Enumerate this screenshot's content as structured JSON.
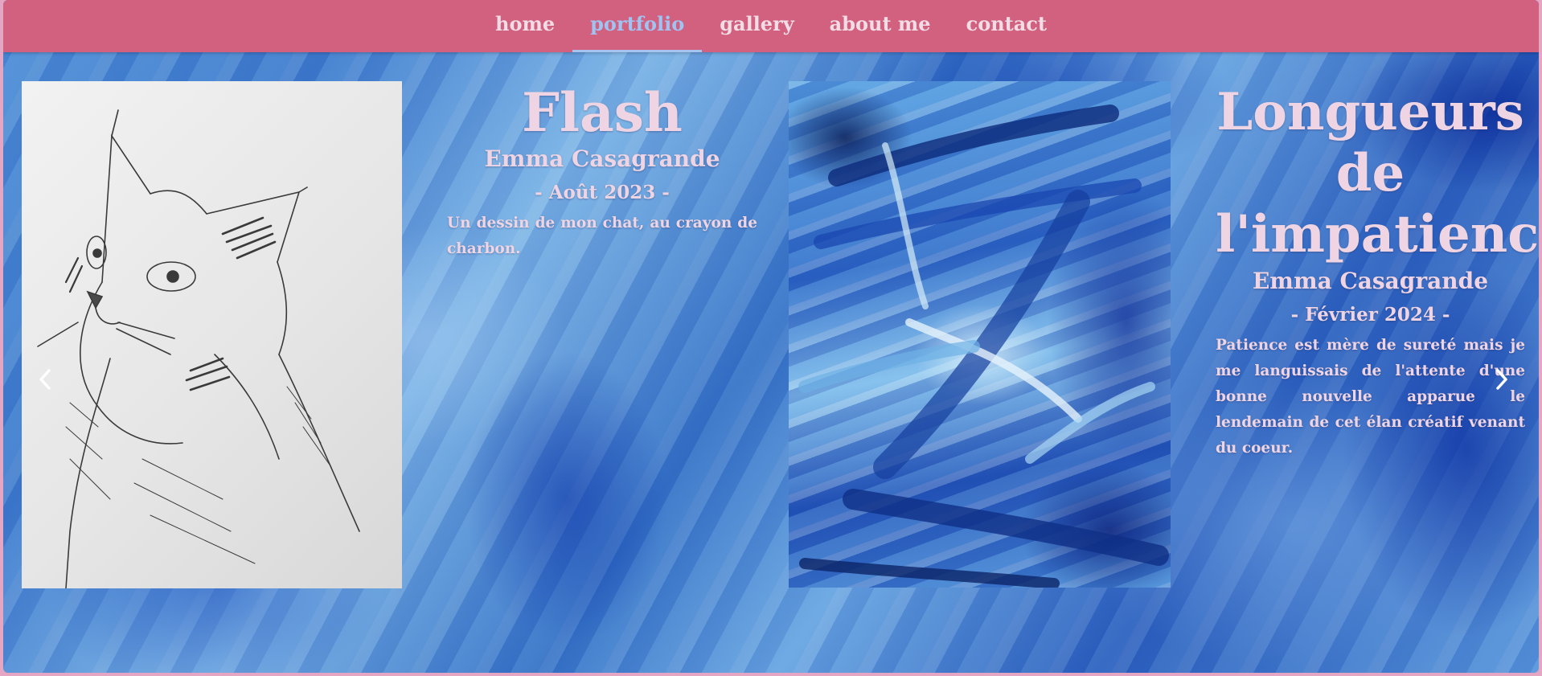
{
  "nav": {
    "items": [
      {
        "label": "home",
        "active": false
      },
      {
        "label": "portfolio",
        "active": true
      },
      {
        "label": "gallery",
        "active": false
      },
      {
        "label": "about me",
        "active": false
      },
      {
        "label": "contact",
        "active": false
      }
    ],
    "background_color": "#d2617f",
    "active_color": "#9fc3f2"
  },
  "carousel": {
    "prev_icon": "chevron-left-icon",
    "next_icon": "chevron-right-icon",
    "artworks": [
      {
        "title": "Flash",
        "author": "Emma Casagrande",
        "date": "- Août 2023 -",
        "description": "Un dessin de mon chat, au crayon de charbon.",
        "image": "pencil-cat-drawing"
      },
      {
        "title": "Longueurs de l'impatience",
        "author": "Emma Casagrande",
        "date": "- Février 2024 -",
        "description": "Patience est mère de sureté mais je me languissais de l'attente d'une bonne nouvelle apparue le lendemain de cet élan créatif venant du coeur.",
        "image": "blue-abstract-painting"
      }
    ]
  },
  "colors": {
    "text": "#efd5e3",
    "page_border": "#e4a6c3"
  }
}
